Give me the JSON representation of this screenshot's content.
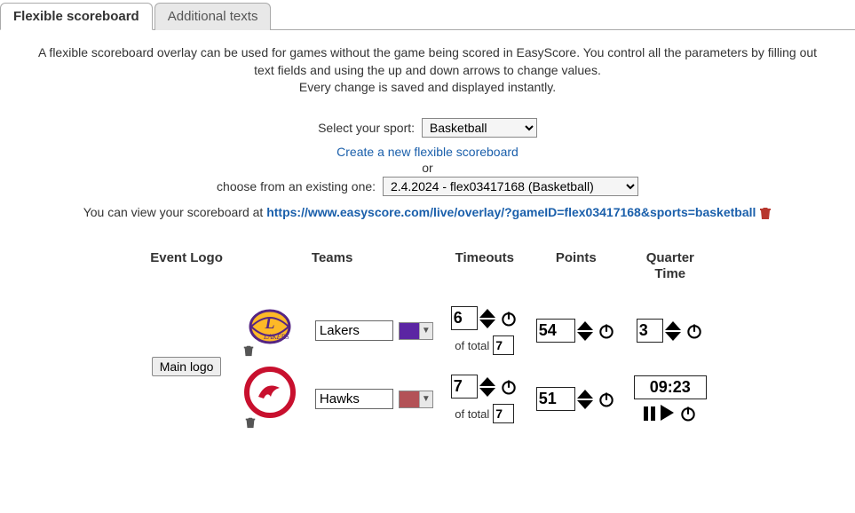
{
  "tabs": {
    "flexible": "Flexible scoreboard",
    "additional": "Additional texts"
  },
  "intro": "A flexible scoreboard overlay can be used for games without the game being scored in EasyScore. You control all the parameters by filling out text fields and using the up and down arrows to change values.",
  "intro2": "Every change is saved and displayed instantly.",
  "sport": {
    "label": "Select your sport:",
    "selected": "Basketball"
  },
  "create_link": "Create a new flexible scoreboard",
  "or_text": "or",
  "choose_label": "choose from an existing one:",
  "existing_selected": "2.4.2024 - flex03417168 (Basketball)",
  "view_prefix": "You can view your scoreboard at ",
  "view_url": "https://www.easyscore.com/live/overlay/?gameID=flex03417168&sports=basketball",
  "headers": {
    "event_logo": "Event Logo",
    "teams": "Teams",
    "timeouts": "Timeouts",
    "points": "Points",
    "quarter_line1": "Quarter",
    "quarter_line2": "Time"
  },
  "main_logo_btn": "Main logo",
  "teams": [
    {
      "name": "Lakers",
      "color": "#5b25a3",
      "timeouts": "6",
      "total_timeouts": "7",
      "points": "54"
    },
    {
      "name": "Hawks",
      "color": "#b35257",
      "timeouts": "7",
      "total_timeouts": "7",
      "points": "51"
    }
  ],
  "quarter": "3",
  "time": "09:23",
  "of_total_label": "of total"
}
